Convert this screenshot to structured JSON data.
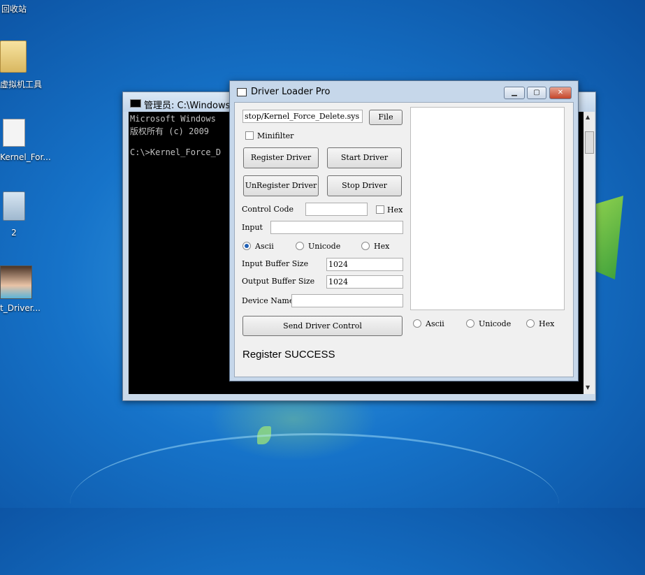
{
  "desktop": {
    "icons": [
      {
        "label": "回收站"
      },
      {
        "label": "虚拟机工具"
      },
      {
        "label": "Kernel_For..."
      },
      {
        "label": "2"
      },
      {
        "label": "t_Driver..."
      }
    ]
  },
  "cmd": {
    "title": "管理员: C:\\Windows\\S",
    "lines": [
      "Microsoft Windows",
      "版权所有 (c) 2009",
      "C:\\>Kernel_Force_D"
    ]
  },
  "dialog": {
    "title": "Driver Loader Pro",
    "path_value": "stop/Kernel_Force_Delete.sys",
    "file_button": "File",
    "minifilter_label": "Minifilter",
    "register_button": "Register Driver",
    "start_button": "Start Driver",
    "unregister_button": "UnRegister Driver",
    "stop_button": "Stop Driver",
    "control_code_label": "Control Code",
    "control_code_value": "",
    "hex_label": "Hex",
    "input_label": "Input",
    "input_value": "",
    "input_format": {
      "selected": "Ascii",
      "options": [
        "Ascii",
        "Unicode",
        "Hex"
      ]
    },
    "input_buffer_label": "Input Buffer Size",
    "input_buffer_value": "1024",
    "output_buffer_label": "Output Buffer Size",
    "output_buffer_value": "1024",
    "device_name_label": "Device Name",
    "device_name_value": "",
    "send_button": "Send Driver Control",
    "output_format": {
      "options": [
        "Ascii",
        "Unicode",
        "Hex"
      ]
    },
    "status": "Register SUCCESS"
  }
}
